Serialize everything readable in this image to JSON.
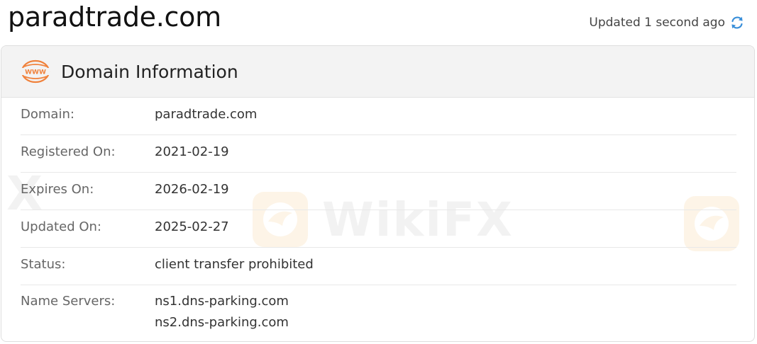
{
  "page": {
    "title": "paradtrade.com",
    "updated_text": "Updated 1 second ago"
  },
  "card": {
    "title": "Domain Information",
    "rows": [
      {
        "label": "Domain:",
        "values": [
          "paradtrade.com"
        ]
      },
      {
        "label": "Registered On:",
        "values": [
          "2021-02-19"
        ]
      },
      {
        "label": "Expires On:",
        "values": [
          "2026-02-19"
        ]
      },
      {
        "label": "Updated On:",
        "values": [
          "2025-02-27"
        ]
      },
      {
        "label": "Status:",
        "values": [
          "client transfer prohibited"
        ]
      },
      {
        "label": "Name Servers:",
        "values": [
          "ns1.dns-parking.com",
          "ns2.dns-parking.com"
        ]
      }
    ]
  },
  "watermark": {
    "text": "WikiFX",
    "fragment": "FX"
  },
  "icons": {
    "header_icon": "www-globe-icon",
    "refresh_icon": "refresh-icon"
  },
  "colors": {
    "accent_orange": "#f0823c",
    "refresh_blue": "#3a8fd9",
    "header_bg": "#f3f3f3"
  }
}
